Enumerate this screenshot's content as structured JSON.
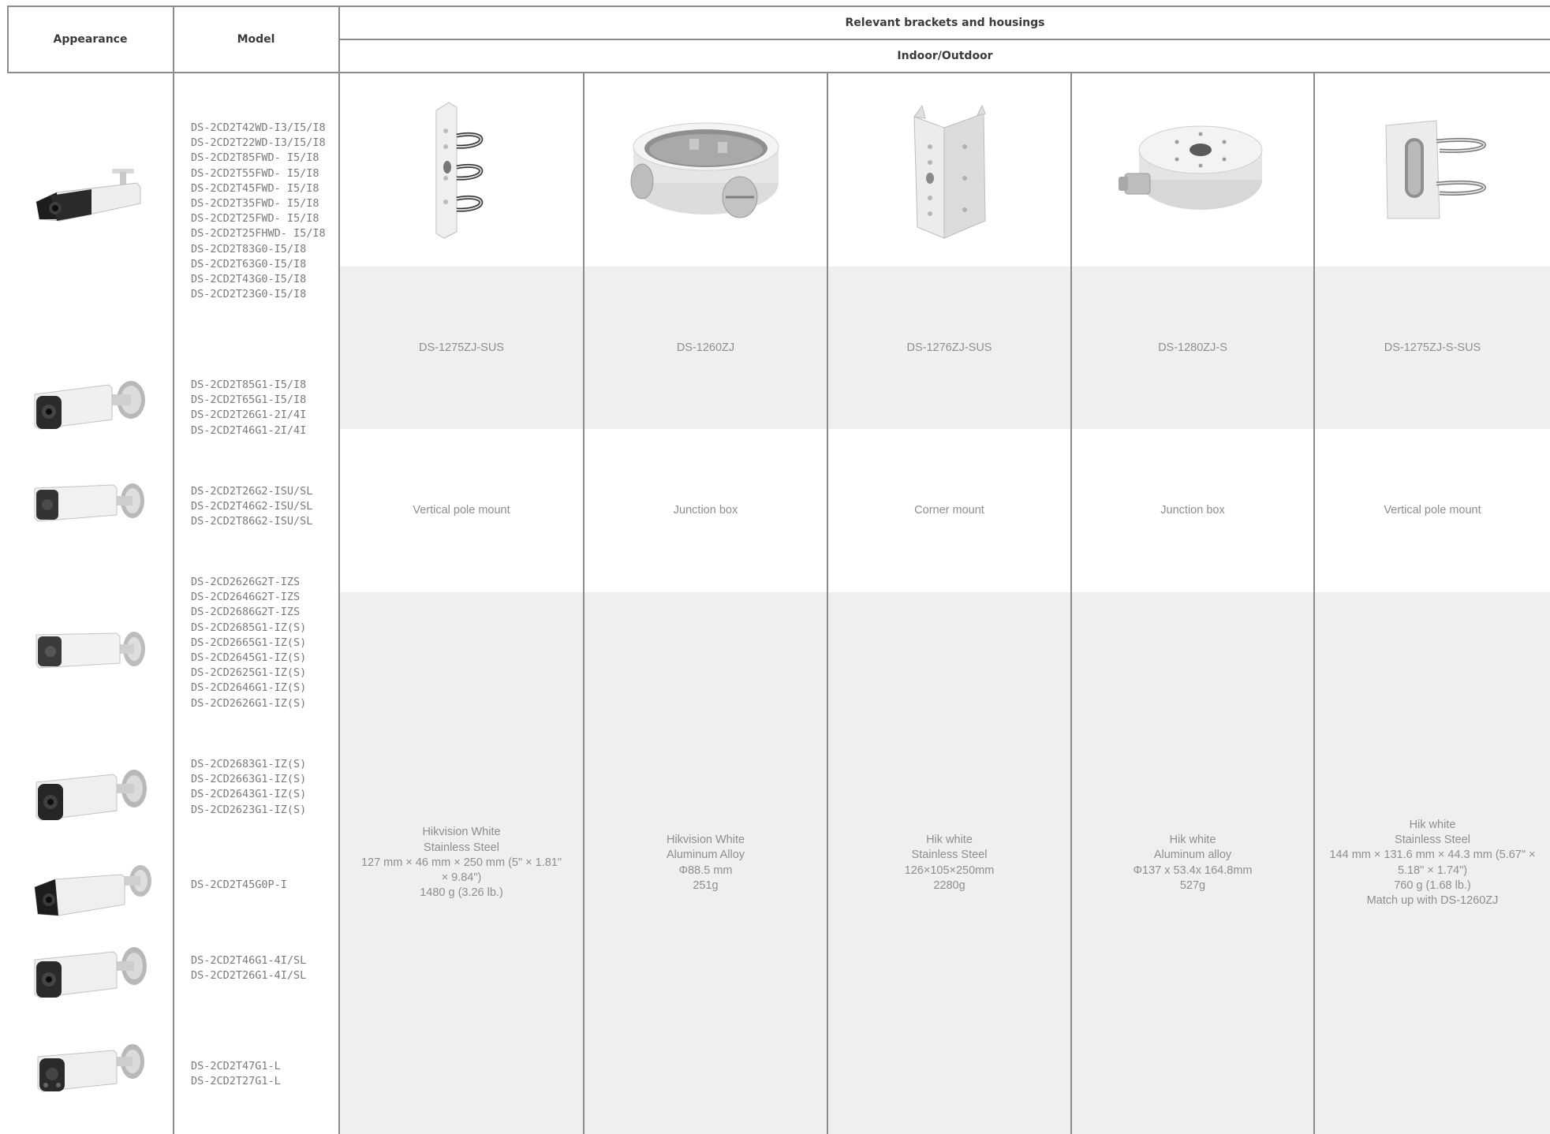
{
  "header": {
    "appearance": "Appearance",
    "model": "Model",
    "relevant": "Relevant brackets and housings",
    "indoor_outdoor": "Indoor/Outdoor"
  },
  "model_groups": [
    [
      "DS-2CD2T42WD-I3/I5/I8",
      "DS-2CD2T22WD-I3/I5/I8",
      "DS-2CD2T85FWD- I5/I8",
      "DS-2CD2T55FWD- I5/I8",
      "DS-2CD2T45FWD- I5/I8",
      "DS-2CD2T35FWD- I5/I8",
      "DS-2CD2T25FWD- I5/I8",
      "DS-2CD2T25FHWD- I5/I8",
      "DS-2CD2T83G0-I5/I8",
      "DS-2CD2T63G0-I5/I8",
      "DS-2CD2T43G0-I5/I8",
      "DS-2CD2T23G0-I5/I8"
    ],
    [
      "DS-2CD2T85G1-I5/I8",
      "DS-2CD2T65G1-I5/I8",
      "DS-2CD2T26G1-2I/4I",
      "DS-2CD2T46G1-2I/4I"
    ],
    [
      "DS-2CD2T26G2-ISU/SL",
      "DS-2CD2T46G2-ISU/SL",
      "DS-2CD2T86G2-ISU/SL"
    ],
    [
      "DS-2CD2626G2T-IZS",
      "DS-2CD2646G2T-IZS",
      "DS-2CD2686G2T-IZS",
      "DS-2CD2685G1-IZ(S)",
      "DS-2CD2665G1-IZ(S)",
      "DS-2CD2645G1-IZ(S)",
      "DS-2CD2625G1-IZ(S)",
      "DS-2CD2646G1-IZ(S)",
      "DS-2CD2626G1-IZ(S)"
    ],
    [
      "DS-2CD2683G1-IZ(S)",
      "DS-2CD2663G1-IZ(S)",
      "DS-2CD2643G1-IZ(S)",
      "DS-2CD2623G1-IZ(S)"
    ],
    [
      "DS-2CD2T45G0P-I"
    ],
    [
      "DS-2CD2T46G1-4I/SL",
      "DS-2CD2T26G1-4I/SL"
    ],
    [
      "DS-2CD2T47G1-L",
      "DS-2CD2T27G1-L"
    ]
  ],
  "brackets": [
    {
      "model": "DS-1275ZJ-SUS",
      "type": "Vertical pole mount",
      "spec": [
        "Hikvision White",
        "Stainless Steel",
        "127 mm × 46 mm × 250 mm (5\" × 1.81\"",
        "× 9.84\")",
        "1480 g (3.26 lb.)"
      ]
    },
    {
      "model": "DS-1260ZJ",
      "type": "Junction box",
      "spec": [
        "Hikvision White",
        "Aluminum Alloy",
        "Φ88.5 mm",
        "251g"
      ]
    },
    {
      "model": "DS-1276ZJ-SUS",
      "type": "Corner mount",
      "spec": [
        "Hik white",
        "Stainless Steel",
        "126×105×250mm",
        "2280g"
      ]
    },
    {
      "model": "DS-1280ZJ-S",
      "type": "Junction box",
      "spec": [
        "Hik white",
        "Aluminum alloy",
        "Φ137 x 53.4x 164.8mm",
        "527g"
      ]
    },
    {
      "model": "DS-1275ZJ-S-SUS",
      "type": "Vertical pole mount",
      "spec": [
        "Hik white",
        "Stainless Steel",
        "144 mm × 131.6 mm × 44.3 mm (5.67\" ×",
        "5.18\" × 1.74\")",
        "760 g (1.68 lb.)",
        "Match up with DS-1260ZJ"
      ]
    }
  ],
  "colors": {
    "band": "#efefef",
    "rule": "#8c8c8c",
    "header_text": "#3a3a3a",
    "body_text": "#8e8e8e"
  },
  "icons": [
    "bullet-camera-image",
    "pole-mount-image",
    "junction-box-image",
    "corner-mount-image"
  ]
}
